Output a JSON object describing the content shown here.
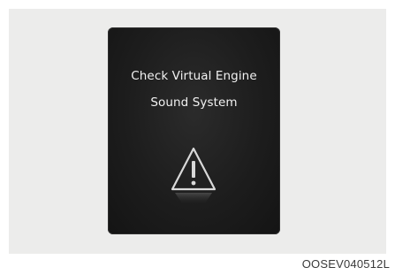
{
  "display": {
    "message_line1": "Check Virtual Engine",
    "message_line2": "Sound System",
    "icon": "warning-triangle-icon"
  },
  "caption": "OOSEV040512L"
}
